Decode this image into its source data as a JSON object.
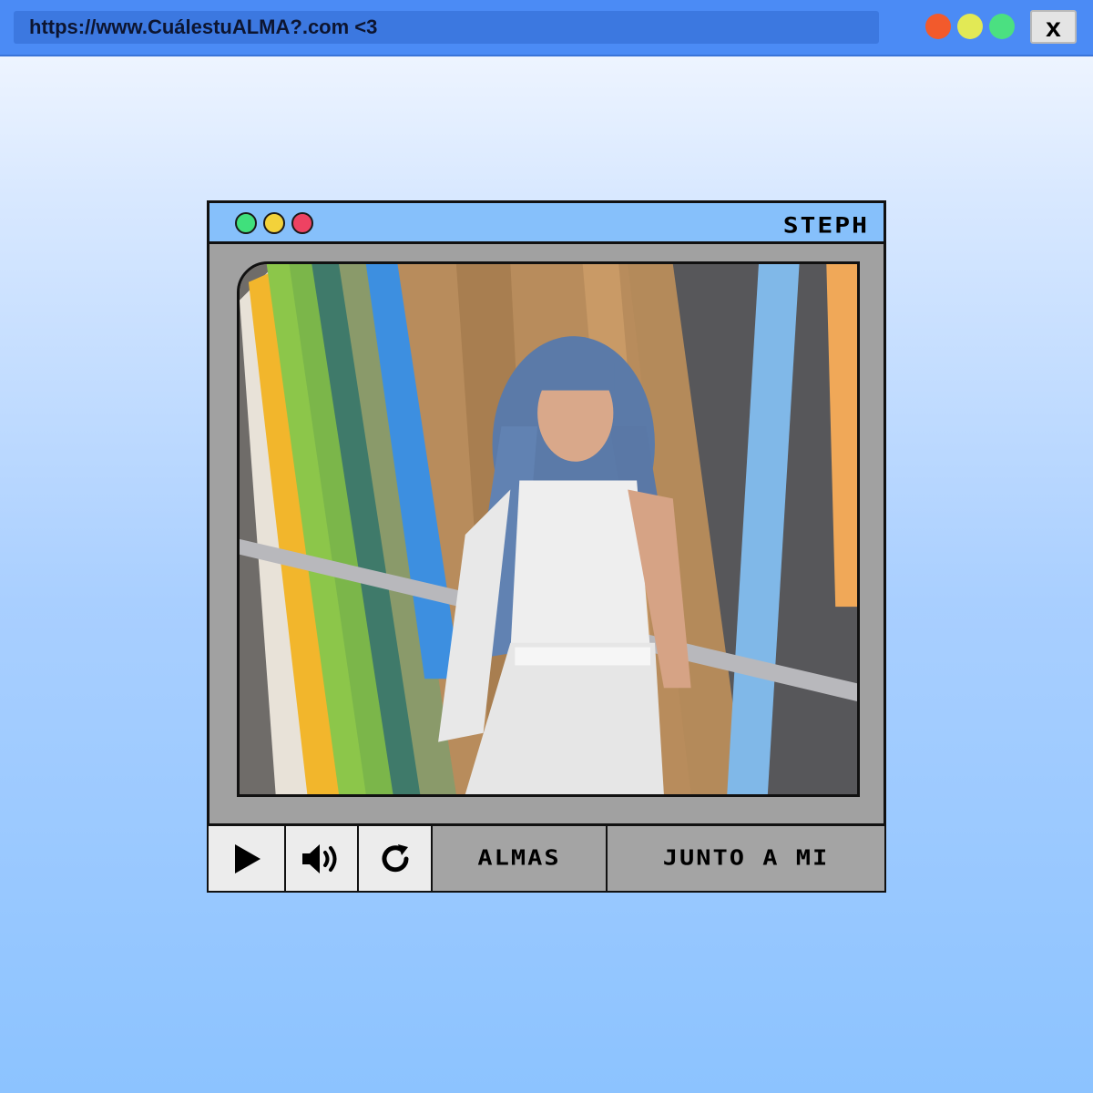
{
  "browser": {
    "url": "https://www.CuálestuALMA?.com <3",
    "close_label": "x"
  },
  "player": {
    "name": "STEPH",
    "controls": {
      "play_icon": "play-icon",
      "volume_icon": "volume-icon",
      "reload_icon": "reload-icon",
      "album_label": "ALMAS",
      "track_label": "JUNTO A MI"
    }
  },
  "colors": {
    "browser_bar": "#4b8bf5",
    "title_bar": "#86c0fb",
    "frame_gray": "#a1a1a1",
    "dot_green": "#40e07c",
    "dot_yellow": "#f3d23a",
    "dot_red": "#ee4262"
  }
}
